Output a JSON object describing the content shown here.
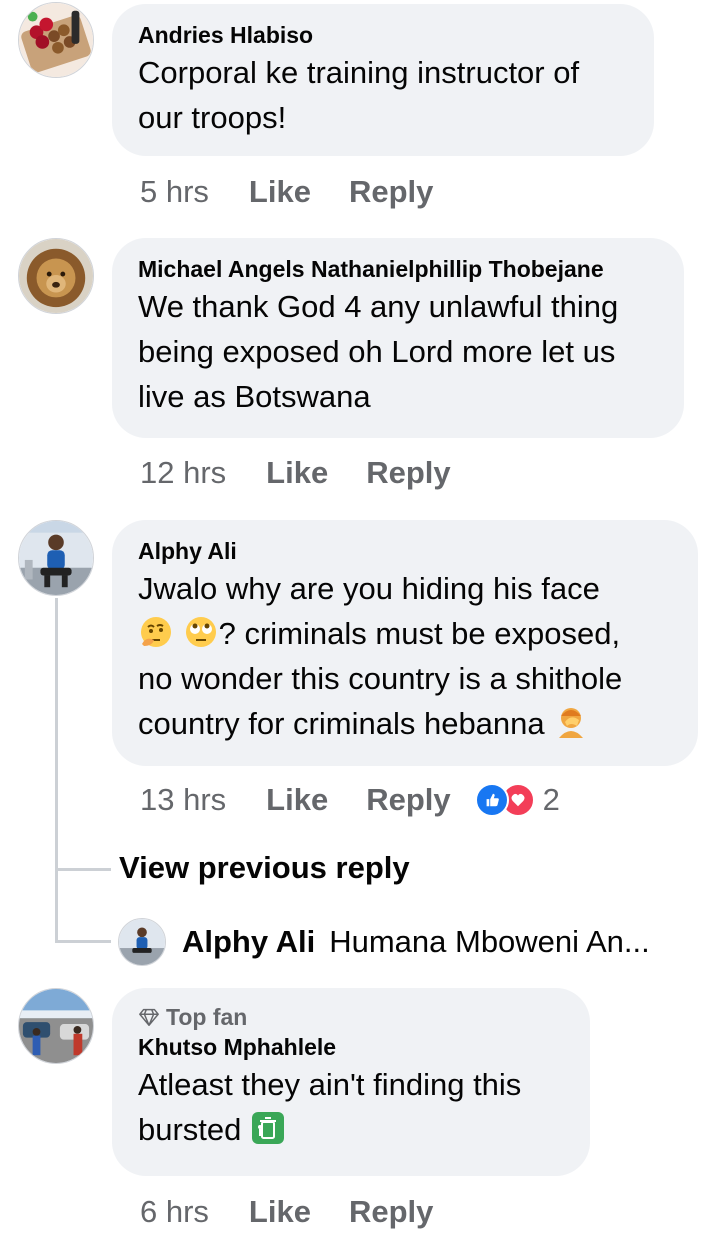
{
  "comments": [
    {
      "author": "Andries Hlabiso",
      "text": "Corporal ke training instructor of our troops!",
      "time": "5 hrs",
      "like": "Like",
      "reply": "Reply"
    },
    {
      "author": "Michael Angels Nathanielphillip Thobejane",
      "text": "We thank God 4 any unlawful thing being exposed oh Lord more let us live as Botswana",
      "time": "12 hrs",
      "like": "Like",
      "reply": "Reply"
    },
    {
      "author": "Alphy Ali",
      "text_line1": "Jwalo why are you hiding his face",
      "text_line2": "? criminals must be exposed,",
      "text_line3": "no wonder this country is a shithole",
      "text_line4": "country for criminals hebanna",
      "time": "13 hrs",
      "like": "Like",
      "reply": "Reply",
      "reaction_count": "2",
      "emojis": [
        "thinking-face-icon",
        "rolling-eyes-icon",
        "facepalm-icon"
      ]
    },
    {
      "badge": "Top fan",
      "author": "Khutso Mphahlele",
      "text_line1": "Atleast they ain't finding this",
      "text_line2": "bursted",
      "time": "6 hrs",
      "like": "Like",
      "reply": "Reply",
      "emoji": "litter-bin-icon"
    }
  ],
  "thread": {
    "view_previous": "View previous reply",
    "reply_author": "Alphy Ali",
    "reply_preview": "Humana Mboweni An..."
  },
  "colors": {
    "bubble": "#f0f2f5",
    "meta_text": "#65676b",
    "like_blue": "#1877f2",
    "love_red": "#f33e58"
  }
}
